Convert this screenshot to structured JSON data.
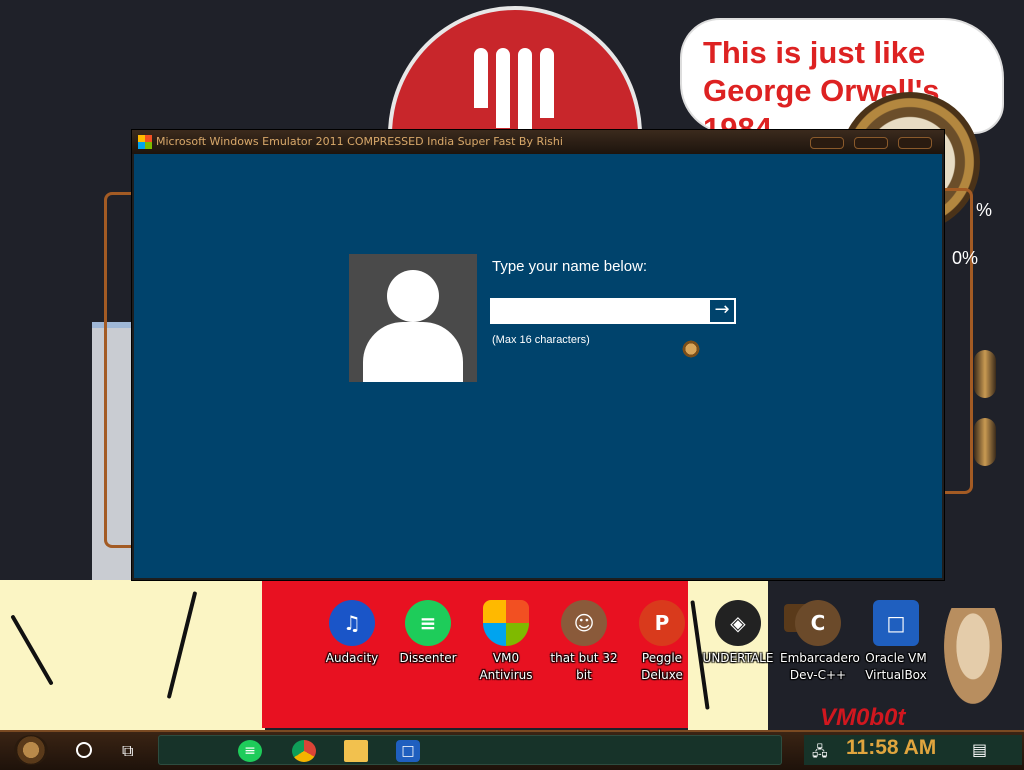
{
  "desktop": {
    "speech_bubble": "This is just like George Orwell's 1984",
    "watermark": "VM0b0t",
    "percent_right_top": "%",
    "percent_right_mid": "0%",
    "gauge_label": "9%",
    "icons": [
      {
        "label": "Audacity",
        "icon": "audacity-icon",
        "color": "#1a55c8"
      },
      {
        "label": "Dissenter",
        "icon": "dissenter-icon",
        "color": "#1ecc5a"
      },
      {
        "label": "VM0 Antivirus",
        "icon": "shield-icon",
        "color": "#e0a700"
      },
      {
        "label": "that but 32 bit",
        "icon": "portrait-icon",
        "color": "#8a5a3a"
      },
      {
        "label": "Peggle Deluxe",
        "icon": "peggle-icon",
        "color": "#d93a1c"
      },
      {
        "label": "UNDERTALE",
        "icon": "unity-icon",
        "color": "#222222"
      },
      {
        "label": "Embarcadero Dev-C++",
        "icon": "devcpp-icon",
        "color": "#6b4a2a"
      },
      {
        "label": "Oracle VM VirtualBox",
        "icon": "virtualbox-icon",
        "color": "#1f5fbf"
      }
    ]
  },
  "window": {
    "title": "Microsoft Windows Emulator 2011 COMPRESSED India Super Fast By Rishi",
    "prompt": "Type your name below:",
    "input_value": "",
    "submit_glyph": "→",
    "hint": "(Max 16 characters)"
  },
  "taskbar": {
    "clock": "11:58 AM",
    "pinned": [
      {
        "name": "dissenter-taskbar-icon",
        "color": "#1ecc5a"
      },
      {
        "name": "chrome-icon",
        "color": "#db4437"
      },
      {
        "name": "file-explorer-icon",
        "color": "#f2c14e"
      },
      {
        "name": "virtualbox-taskbar-icon",
        "color": "#1f5fbf"
      }
    ]
  },
  "colors": {
    "client_bg": "#00436c",
    "taskbar_accent": "#e0a53e"
  }
}
